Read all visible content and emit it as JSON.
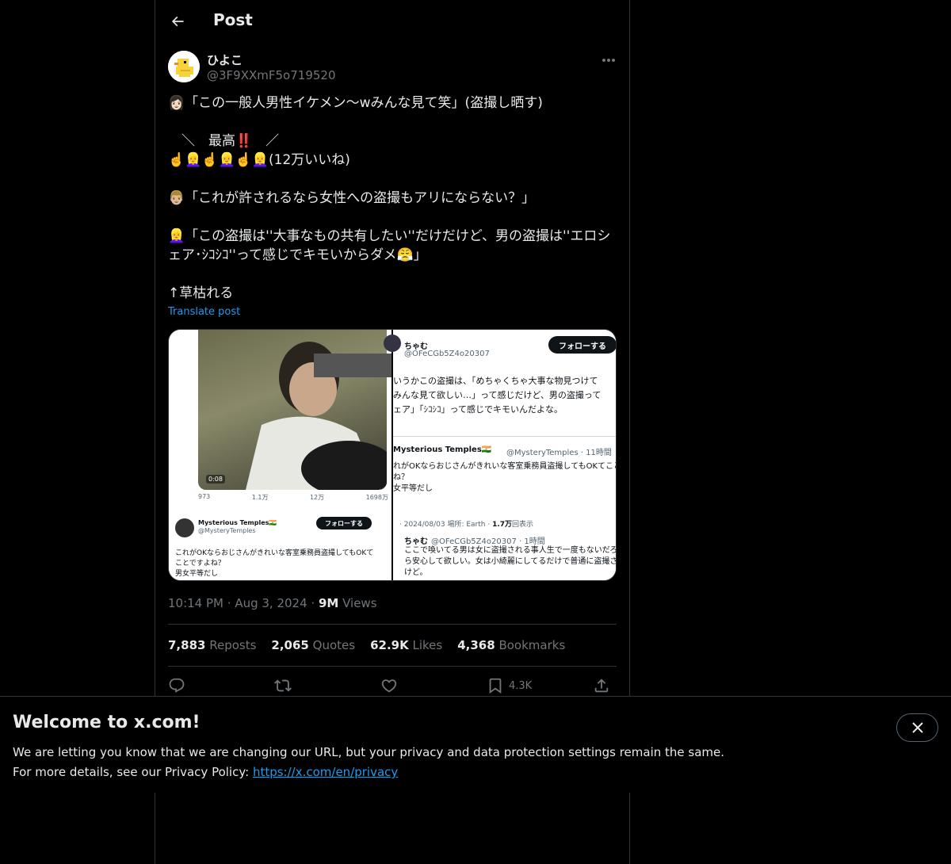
{
  "header": {
    "title": "Post"
  },
  "author": {
    "display_name": "ひよこ",
    "handle": "@3F9XXmF5o719520"
  },
  "tweet": {
    "lines": [
      "👩🏻「この一般人男性イケメン〜wみんな見て笑」(盗撮し晒す)",
      "",
      "　＼　最高‼️　／",
      "☝️👱‍♀️☝️👱‍♀️☝️👱‍♀️(12万いいね)",
      "",
      "👨🏼「これが許されるなら女性への盗撮もアリにならない？」",
      "",
      "👱‍♀️「この盗撮は''大事なもの共有したい''だけだけど、男の盗撮は''エロシ",
      "ェア･ｼｺｼｺ''って感じでキモいからダメ😤」",
      "",
      "↑草枯れる"
    ],
    "translate_label": "Translate post"
  },
  "media": {
    "left": {
      "video_time": "0:08",
      "stats": [
        "973",
        "1.1万",
        "12万",
        "1698万"
      ],
      "card_name": "Mysterious Temples🇮🇳",
      "card_handle": "@MysteryTemples",
      "card_follow": "フォローする",
      "card_text_lines": [
        "これがOKならおじさんがきれいな客室乗務員盗撮してもOKて",
        "ことですよね？",
        "男女平等だし"
      ]
    },
    "right": {
      "name": "ちゃむ",
      "handle": "@OFeCGb5Z4o20307",
      "follow": "フォローする",
      "text_lines": [
        "いうかこの盗撮は、「めちゃくちゃ大事な物見つけて",
        "みんな見て欲しい…」って感じだけど、男の盗撮って",
        "ェア」「ｼｺｼｺ」って感じでキモいんだよな。"
      ],
      "quote_name": "Mysterious Temples🇮🇳",
      "quote_handle": "@MysteryTemples · 11時間",
      "quote_lines": [
        "れがOKならおじさんがきれいな客室乗務員盗撮してもOKてこと",
        "ね？",
        "女平等だし"
      ],
      "meta_prefix": "· 2024/08/03 場所: Earth · ",
      "meta_views": "1.7万",
      "meta_suffix": "回表示",
      "reply_name": "ちゃむ",
      "reply_handle": "@OFeCGb5Z4o20307 · 1時間",
      "reply_lines": [
        "ここで喚いてる男は女に盗撮される事人生で一度もないだろ",
        "ら安心して欲しい。女は小綺麗にしてるだけで普通に盗撮さ",
        "けど。"
      ]
    }
  },
  "meta": {
    "time": "10:14 PM",
    "date": "Aug 3, 2024",
    "views": "9M",
    "views_label": "Views"
  },
  "stats": [
    {
      "count": "7,883",
      "label": "Reposts"
    },
    {
      "count": "2,065",
      "label": "Quotes"
    },
    {
      "count": "62.9K",
      "label": "Likes"
    },
    {
      "count": "4,368",
      "label": "Bookmarks"
    }
  ],
  "actions": {
    "bookmark_count": "4.3K"
  },
  "banner": {
    "title": "Welcome to x.com!",
    "line1": "We are letting you know that we are changing our URL, but your privacy and data protection settings remain the same.",
    "line2_prefix": "For more details, see our Privacy Policy: ",
    "link": "https://x.com/en/privacy"
  },
  "colors": {
    "accent": "#1d9bf0",
    "background": "#000000",
    "border": "#2f3336",
    "muted": "#71767b"
  },
  "icons": [
    "back-arrow-icon",
    "more-icon",
    "reply-icon",
    "repost-icon",
    "like-icon",
    "bookmark-icon",
    "share-icon",
    "close-icon"
  ]
}
